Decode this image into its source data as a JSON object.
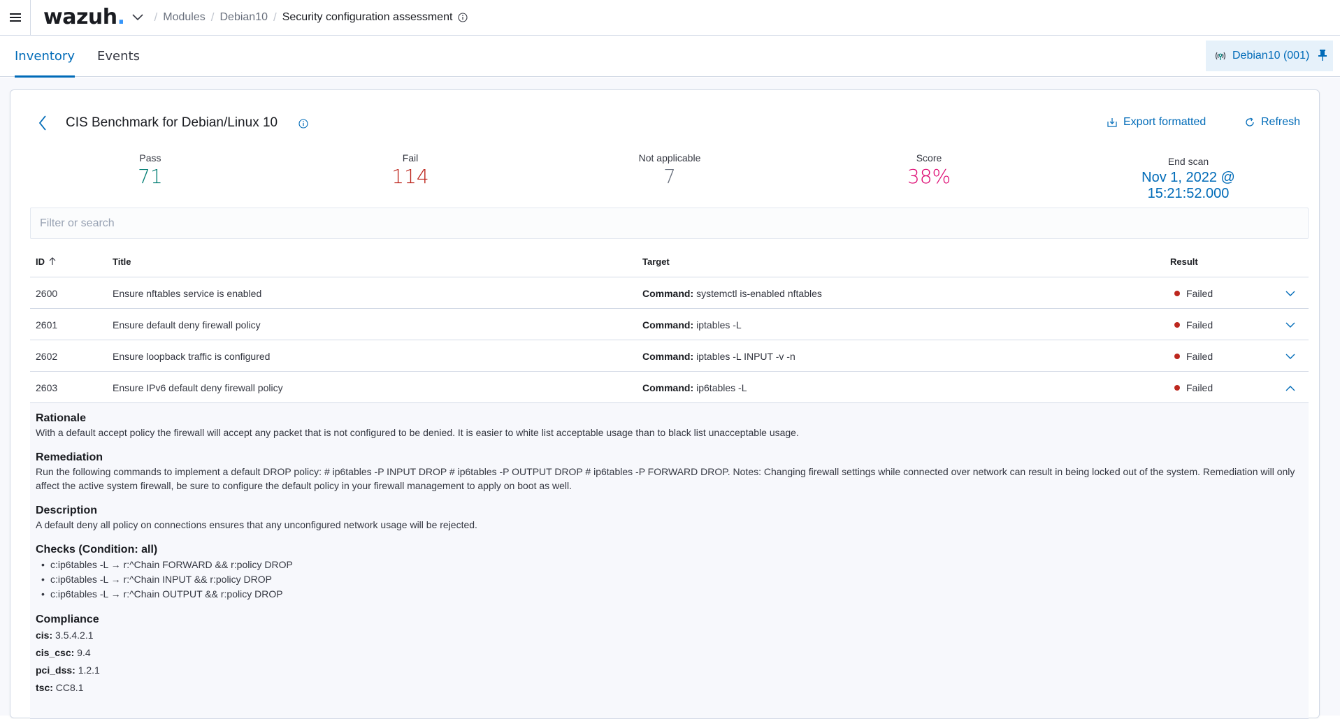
{
  "header": {
    "logo_text": "wazuh",
    "logo_dot": ".",
    "breadcrumbs": [
      "Modules",
      "Debian10",
      "Security configuration assessment"
    ]
  },
  "tabs": [
    {
      "label": "Inventory",
      "active": true
    },
    {
      "label": "Events",
      "active": false
    }
  ],
  "agent": {
    "label": "Debian10 (001)"
  },
  "panel": {
    "title": "CIS Benchmark for Debian/Linux 10",
    "export_label": "Export formatted",
    "refresh_label": "Refresh",
    "stats": {
      "pass": {
        "label": "Pass",
        "value": "71",
        "color": "#017d73"
      },
      "fail": {
        "label": "Fail",
        "value": "114",
        "color": "#bd271e"
      },
      "not_applicable": {
        "label": "Not applicable",
        "value": "7",
        "color": "#69707d"
      },
      "score": {
        "label": "Score",
        "value": "38%",
        "color": "#dd0a73"
      },
      "end_scan": {
        "label": "End scan",
        "value": "Nov 1, 2022 @ 15:21:52.000",
        "color": "#006bb8"
      }
    },
    "search_placeholder": "Filter or search"
  },
  "table": {
    "columns": {
      "id": "ID",
      "title": "Title",
      "target": "Target",
      "result": "Result"
    },
    "rows": [
      {
        "id": "2600",
        "title": "Ensure nftables service is enabled",
        "target_label": "Command:",
        "target_value": "systemctl is-enabled nftables",
        "result": "Failed",
        "expanded": false
      },
      {
        "id": "2601",
        "title": "Ensure default deny firewall policy",
        "target_label": "Command:",
        "target_value": "iptables -L",
        "result": "Failed",
        "expanded": false
      },
      {
        "id": "2602",
        "title": "Ensure loopback traffic is configured",
        "target_label": "Command:",
        "target_value": "iptables -L INPUT -v -n",
        "result": "Failed",
        "expanded": false
      },
      {
        "id": "2603",
        "title": "Ensure IPv6 default deny firewall policy",
        "target_label": "Command:",
        "target_value": "ip6tables -L",
        "result": "Failed",
        "expanded": true
      }
    ],
    "details": {
      "rationale_heading": "Rationale",
      "rationale": "With a default accept policy the firewall will accept any packet that is not configured to be denied. It is easier to white list acceptable usage than to black list unacceptable usage.",
      "remediation_heading": "Remediation",
      "remediation": "Run the following commands to implement a default DROP policy: # ip6tables -P INPUT DROP # ip6tables -P OUTPUT DROP # ip6tables -P FORWARD DROP. Notes: Changing firewall settings while connected over network can result in being locked out of the system. Remediation will only affect the active system firewall, be sure to configure the default policy in your firewall management to apply on boot as well.",
      "description_heading": "Description",
      "description": "A default deny all policy on connections ensures that any unconfigured network usage will be rejected.",
      "checks_heading": "Checks (Condition: all)",
      "checks": [
        "c:ip6tables -L → r:^Chain FORWARD && r:policy DROP",
        "c:ip6tables -L → r:^Chain INPUT && r:policy DROP",
        "c:ip6tables -L → r:^Chain OUTPUT && r:policy DROP"
      ],
      "compliance_heading": "Compliance",
      "compliance": [
        {
          "key": "cis:",
          "value": "3.5.4.2.1"
        },
        {
          "key": "cis_csc:",
          "value": "9.4"
        },
        {
          "key": "pci_dss:",
          "value": "1.2.1"
        },
        {
          "key": "tsc:",
          "value": "CC8.1"
        }
      ]
    }
  },
  "colors": {
    "accent": "#006bb8",
    "failed": "#bd271e"
  }
}
